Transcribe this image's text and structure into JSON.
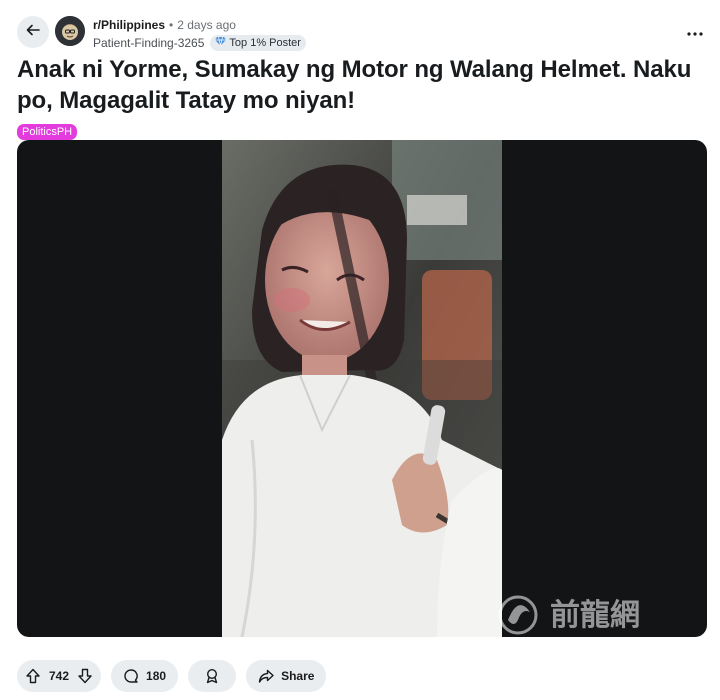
{
  "header": {
    "subreddit": "r/Philippines",
    "separator": "•",
    "time": "2 days ago",
    "author": "Patient-Finding-3265",
    "author_flair": "Top 1% Poster",
    "back_icon": "arrow-left-icon",
    "more_icon": "more-horizontal-icon"
  },
  "post": {
    "title": "Anak ni Yorme, Sumakay ng Motor ng Walang Helmet. Naku po, Magagalit Tatay mo niyan!",
    "flair": "PoliticsPH",
    "flair_color": "#e43bde"
  },
  "media": {
    "type": "video",
    "description_icon": "video-thumbnail",
    "background": "#121416"
  },
  "watermark": {
    "text": "前龍網"
  },
  "actions": {
    "upvotes": "742",
    "comments": "180",
    "share_label": "Share"
  }
}
